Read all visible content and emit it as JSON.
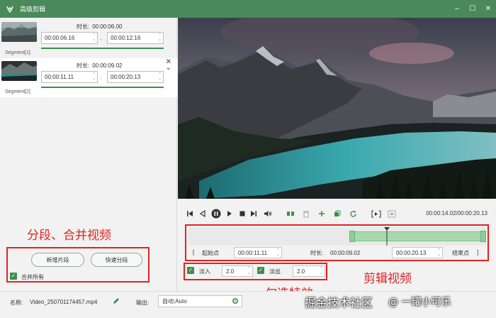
{
  "titlebar": {
    "title": "高级剪辑",
    "minimize": "–",
    "maximize": "☐",
    "close": "✕"
  },
  "segments": [
    {
      "label": "Segment[1]",
      "duration_label": "时长:",
      "duration": "00:00:06.00",
      "start": "00:00:06.16",
      "end": "00:00:12.16",
      "dash": "-"
    },
    {
      "label": "Segment[2]",
      "duration_label": "时长:",
      "duration": "00:00:09.02",
      "start": "00:00:11.11",
      "end": "00:00:20.13",
      "dash": "-"
    }
  ],
  "left_panel": {
    "annotation": "分段、合并视频",
    "add_segment": "新增片段",
    "quick_split": "快速分段",
    "merge_all": "合并所有"
  },
  "player": {
    "timecode": "00:00:14.02/00:00:20.13"
  },
  "trim": {
    "start_label": "起始点",
    "start_value": "00:00:11.11",
    "duration_label": "时长:",
    "duration_value": "00:00:09.02",
    "end_value": "00:00:20.13",
    "end_label": "结束点",
    "bracket_left": "[",
    "bracket_right": "]"
  },
  "effects": {
    "fade_in_label": "淡入",
    "fade_in_value": "2.0",
    "fade_out_label": "淡出",
    "fade_out_value": "2.0"
  },
  "annotations": {
    "trim_video": "剪辑视频",
    "check_effects": "勾选特效"
  },
  "bottom": {
    "name_label": "名称:",
    "name_value": "Video_250701174457.mp4",
    "output_label": "输出:",
    "output_value": "自动;Auto"
  },
  "watermark": {
    "site": "掘金技术社区",
    "author": "@ 一罐小可乐"
  },
  "colors": {
    "accent": "#3d8f4c",
    "titlebar": "#4a8a5a",
    "annotation": "#e32222"
  }
}
